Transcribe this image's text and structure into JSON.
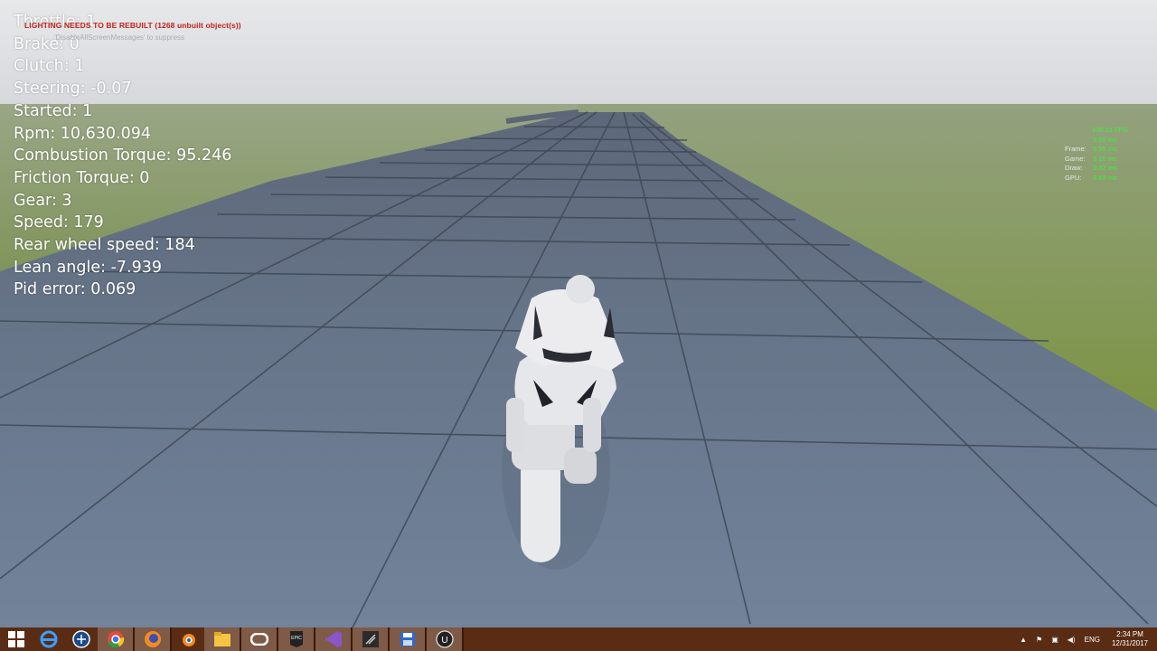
{
  "hud": {
    "throttle": "Throttle: 1",
    "brake": "Brake: 0",
    "clutch": "Clutch: 1",
    "steering": "Steering: -0.07",
    "started": "Started: 1",
    "rpm": "Rpm: 10,630.094",
    "combustion_torque": "Combustion Torque: 95.246",
    "friction_torque": "Friction Torque: 0",
    "gear": "Gear: 3",
    "speed": "Speed: 179",
    "rear_wheel_speed": "Rear wheel speed: 184",
    "lean_angle": "Lean angle: -7.939",
    "pid_error": "Pid error: 0.069"
  },
  "warning": {
    "text": "LIGHTING NEEDS TO BE REBUILT (1268 unbuilt object(s))",
    "suppress": "'DisableAllScreenMessages' to suppress"
  },
  "stats": {
    "fps": "100.51 FPS",
    "fps_ms": "9.95 ms",
    "frame_label": "Frame:",
    "frame_value": "9.95 ms",
    "game_label": "Game:",
    "game_value": "5.10 ms",
    "draw_label": "Draw:",
    "draw_value": "9.32 ms",
    "gpu_label": "GPU:",
    "gpu_value": "9.69 ms"
  },
  "taskbar": {
    "apps": [
      "windows-start-icon",
      "internet-explorer-icon",
      "app-icon",
      "chrome-icon",
      "firefox-icon",
      "blender-icon",
      "file-explorer-icon",
      "oculus-icon",
      "epic-games-icon",
      "visual-studio-icon",
      "unreal-editor-icon",
      "save-disk-icon",
      "unreal-engine-icon"
    ],
    "language": "ENG",
    "time": "2:34 PM",
    "date": "12/31/2017"
  },
  "colors": {
    "sky_top": "#e6e8ea",
    "grass": "#7e9449",
    "road": "#6b7a8f",
    "taskbar": "#5a2c14"
  }
}
